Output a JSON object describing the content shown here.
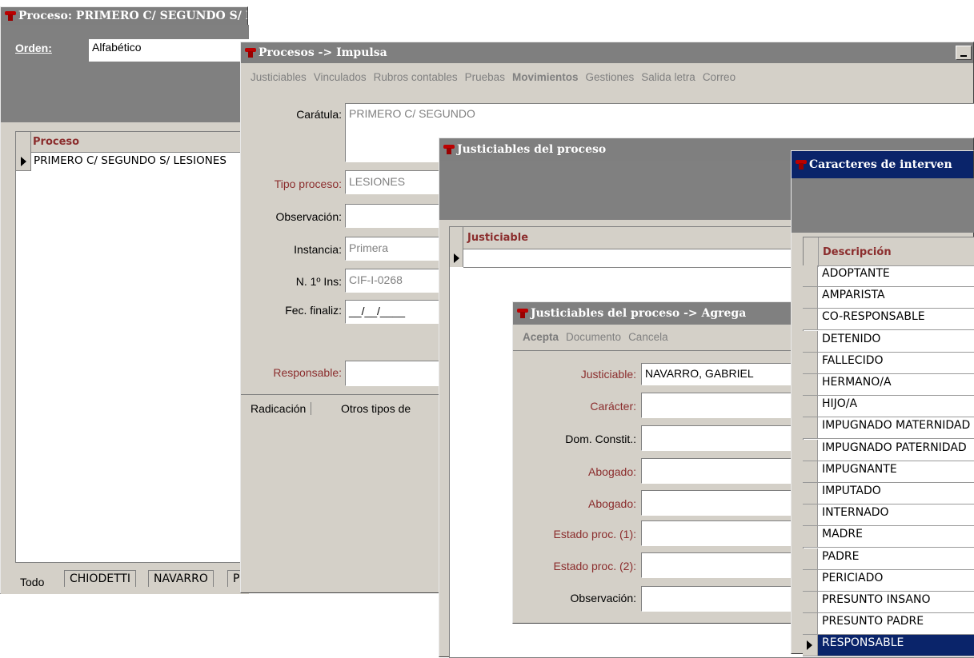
{
  "win1": {
    "title": "Proceso: PRIMERO C/ SEGUNDO S/ LESIONES",
    "orden_label": "Orden:",
    "orden_value": "Alfabético",
    "grid_header": "Proceso",
    "grid_row": "PRIMERO C/ SEGUNDO S/ LESIONES",
    "tabs": [
      "Todo",
      "CHIODETTI",
      "NAVARRO",
      "P"
    ]
  },
  "win2": {
    "title": "Procesos -> Impulsa",
    "menu": [
      "Justiciables",
      "Vinculados",
      "Rubros contables",
      "Pruebas",
      "Movimientos",
      "Gestiones",
      "Salida letra",
      "Correo"
    ],
    "caratula_label": "Carátula:",
    "caratula_value": "PRIMERO C/ SEGUNDO",
    "tipo_label": "Tipo proceso:",
    "tipo_value": "LESIONES",
    "observacion_label": "Observación:",
    "observacion_value": "",
    "instancia_label": "Instancia:",
    "instancia_value": "Primera",
    "n1ins_label": "N. 1º Ins:",
    "n1ins_value": "CIF-I-0268",
    "fecfin_label": "Fec. finaliz:",
    "fecfin_value": "__/__/____",
    "responsable_label": "Responsable:",
    "responsable_value": "",
    "tabs": [
      "Radicación",
      "Otros tipos de"
    ]
  },
  "win3": {
    "title": "Justiciables del proceso",
    "grid_header": "Justiciable"
  },
  "win4": {
    "title": "Justiciables del proceso -> Agrega",
    "menu": [
      "Acepta",
      "Documento",
      "Cancela"
    ],
    "justiciable_label": "Justiciable:",
    "justiciable_value": "NAVARRO, GABRIEL",
    "caracter_label": "Carácter:",
    "domconstit_label": "Dom. Constit.:",
    "abogado1_label": "Abogado:",
    "abogado2_label": "Abogado:",
    "estado1_label": "Estado proc. (1):",
    "estado2_label": "Estado proc. (2):",
    "observacion_label": "Observación:"
  },
  "win5": {
    "title": "Caracteres de interven",
    "grid_header": "Descripción",
    "items": [
      "ADOPTANTE",
      "AMPARISTA",
      "CO-RESPONSABLE",
      "DETENIDO",
      "FALLECIDO",
      "HERMANO/A",
      "HIJO/A",
      "IMPUGNADO MATERNIDAD",
      "IMPUGNADO PATERNIDAD",
      "IMPUGNANTE",
      "IMPUTADO",
      "INTERNADO",
      "MADRE",
      "PADRE",
      "PERICIADO",
      "PRESUNTO INSANO",
      "PRESUNTO PADRE",
      "RESPONSABLE"
    ],
    "selected_index": 17
  },
  "colors": {
    "titlebar": "#7f7f7f",
    "selection": "#0a246a",
    "label_red": "#8b2d2d",
    "face": "#d4d0c8"
  }
}
